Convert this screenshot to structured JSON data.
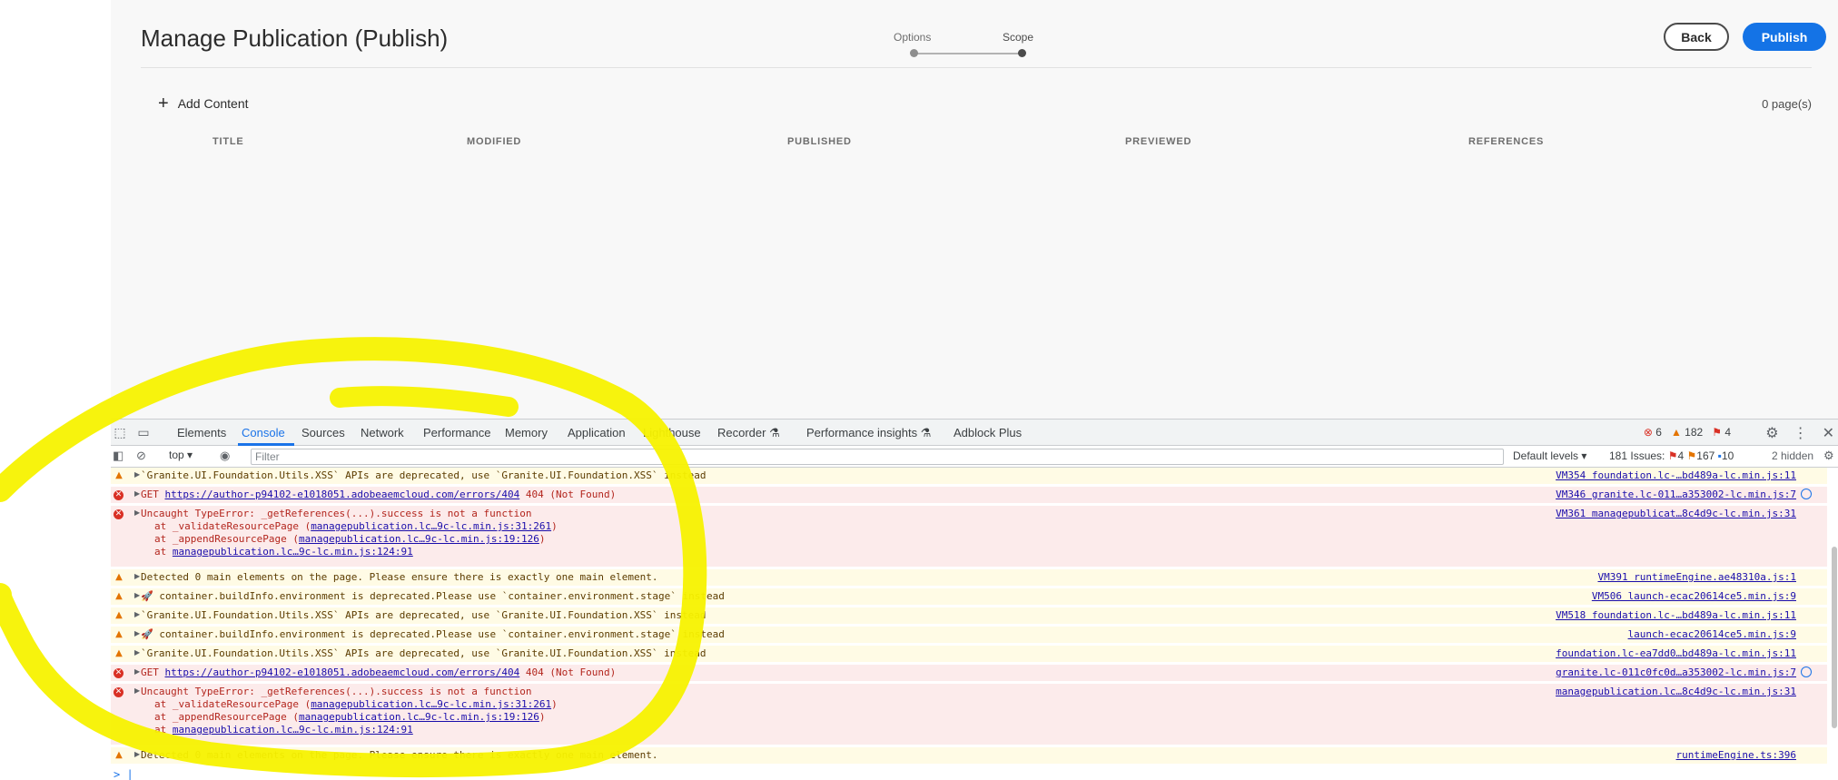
{
  "app": {
    "title": "Manage Publication (Publish)",
    "wizard": {
      "step1": "Options",
      "step2": "Scope"
    },
    "back_label": "Back",
    "publish_label": "Publish",
    "add_content_label": "Add Content",
    "pages_count": "0 page(s)",
    "columns": [
      "TITLE",
      "MODIFIED",
      "PUBLISHED",
      "PREVIEWED",
      "REFERENCES"
    ]
  },
  "devtools": {
    "tabs": [
      "Elements",
      "Console",
      "Sources",
      "Network",
      "Performance",
      "Memory",
      "Application",
      "Lighthouse",
      "Recorder",
      "Performance insights",
      "Adblock Plus"
    ],
    "active_tab": "Console",
    "error_count": "6",
    "warning_count": "182",
    "issue_badge_count": "4",
    "context": "top",
    "filter_placeholder": "Filter",
    "levels": "Default levels",
    "issues_label": "181 Issues:",
    "issues_errors": "4",
    "issues_warnings": "167",
    "issues_info": "10",
    "hidden": "2 hidden"
  },
  "console": {
    "rows": [
      {
        "type": "warn",
        "msg": "`Granite.UI.Foundation.Utils.XSS` APIs are deprecated, use `Granite.UI.Foundation.XSS` instead",
        "src": "VM354 foundation.lc-…bd489a-lc.min.js:11"
      },
      {
        "type": "error",
        "msg_prefix": "GET ",
        "url": "https://author-p94102-e1018051.adobeaemcloud.com/errors/404",
        "msg_suffix": " 404 (Not Found)",
        "src": "VM346 granite.lc-011…a353002-lc.min.js:7"
      },
      {
        "type": "error",
        "msg": "Uncaught TypeError: _getReferences(...).success is not a function",
        "src": "VM361 managepublicat…8c4d9c-lc.min.js:31",
        "stack": [
          {
            "pre": "at _validateResourcePage (",
            "link": "managepublication.lc…9c-lc.min.js:31:261",
            "post": ")"
          },
          {
            "pre": "at _appendResourcePage (",
            "link": "managepublication.lc…9c-lc.min.js:19:126",
            "post": ")"
          },
          {
            "pre": "at ",
            "link": "managepublication.lc…9c-lc.min.js:124:91",
            "post": ""
          }
        ]
      },
      {
        "type": "warn",
        "msg": "Detected 0 main elements on the page. Please ensure there is exactly one main element.",
        "src": "VM391 runtimeEngine.ae48310a.js:1"
      },
      {
        "type": "warn",
        "msg": "🚀 container.buildInfo.environment is deprecated.Please use `container.environment.stage` instead",
        "src": "VM506 launch-ecac20614ce5.min.js:9"
      },
      {
        "type": "warn",
        "msg": "`Granite.UI.Foundation.Utils.XSS` APIs are deprecated, use `Granite.UI.Foundation.XSS` instead",
        "src": "VM518 foundation.lc-…bd489a-lc.min.js:11"
      },
      {
        "type": "warn",
        "msg": "🚀 container.buildInfo.environment is deprecated.Please use `container.environment.stage` instead",
        "src": "launch-ecac20614ce5.min.js:9"
      },
      {
        "type": "warn",
        "msg": "`Granite.UI.Foundation.Utils.XSS` APIs are deprecated, use `Granite.UI.Foundation.XSS` instead",
        "src": "foundation.lc-ea7dd0…bd489a-lc.min.js:11"
      },
      {
        "type": "error",
        "msg_prefix": "GET ",
        "url": "https://author-p94102-e1018051.adobeaemcloud.com/errors/404",
        "msg_suffix": " 404 (Not Found)",
        "src": "granite.lc-011c0fc0d…a353002-lc.min.js:7"
      },
      {
        "type": "error",
        "msg": "Uncaught TypeError: _getReferences(...).success is not a function",
        "src": "managepublication.lc…8c4d9c-lc.min.js:31",
        "stack": [
          {
            "pre": "at _validateResourcePage (",
            "link": "managepublication.lc…9c-lc.min.js:31:261",
            "post": ")"
          },
          {
            "pre": "at _appendResourcePage (",
            "link": "managepublication.lc…9c-lc.min.js:19:126",
            "post": ")"
          },
          {
            "pre": "at ",
            "link": "managepublication.lc…9c-lc.min.js:124:91",
            "post": ""
          }
        ]
      },
      {
        "type": "warn",
        "msg": "Detected 0 main elements on the page. Please ensure there is exactly one main element.",
        "src": "runtimeEngine.ts:396"
      }
    ]
  },
  "colors": {
    "accent": "#1473e6",
    "annotation": "#ffff00",
    "error_bg": "#fcebeb",
    "warn_bg": "#fffbe5"
  }
}
